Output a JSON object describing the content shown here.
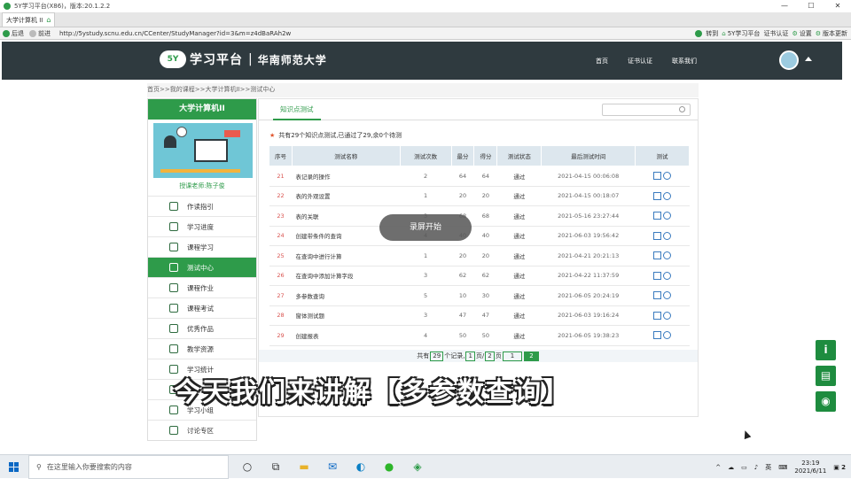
{
  "window": {
    "title": "5Y学习平台(X86)，版本:20.1.2.2"
  },
  "tabs": [
    {
      "label": "大学计算机 II"
    }
  ],
  "address": {
    "back": "后退",
    "forward": "前进",
    "url": "http://5ystudy.scnu.edu.cn/CCenter/StudyManager?id=3&m=z4dBaRAh2w",
    "right_items": [
      "转到",
      "5Y学习平台",
      "证书认证",
      "设置",
      "版本更新"
    ]
  },
  "site": {
    "logo_badge": "5Y",
    "title": "学习平台",
    "separator": "|",
    "university": "华南师范大学",
    "nav": [
      "首页",
      "证书认证",
      "联系我们"
    ]
  },
  "breadcrumb": "首页>>我的课程>>大学计算机II>>测试中心",
  "sidebar": {
    "course": "大学计算机II",
    "teacher_link": "授课老师:陈子俊",
    "items": [
      {
        "label": "作读指引",
        "icon": "chart-icon"
      },
      {
        "label": "学习进度",
        "icon": "progress-icon"
      },
      {
        "label": "课程学习",
        "icon": "graduation-icon"
      },
      {
        "label": "测试中心",
        "icon": "list-icon",
        "active": true
      },
      {
        "label": "课程作业",
        "icon": "homework-icon"
      },
      {
        "label": "课程考试",
        "icon": "exam-icon"
      },
      {
        "label": "优秀作品",
        "icon": "award-icon"
      },
      {
        "label": "教学资源",
        "icon": "resource-icon"
      },
      {
        "label": "学习统计",
        "icon": "stats-icon"
      },
      {
        "label": "课程公告",
        "icon": "notice-icon"
      },
      {
        "label": "学习小组",
        "icon": "group-icon"
      },
      {
        "label": "讨论专区",
        "icon": "discuss-icon"
      }
    ]
  },
  "main": {
    "tab": "知识点测试",
    "summary": "共有29个知识点测试,已通过了29,余0个待测",
    "columns": [
      "序号",
      "测试名称",
      "测试次数",
      "最分",
      "得分",
      "测试状态",
      "最后测试时间",
      "测试"
    ],
    "rows": [
      [
        "21",
        "表记录的操作",
        "2",
        "64",
        "64",
        "通过",
        "2021-04-15 00:06:08"
      ],
      [
        "22",
        "表的外观设置",
        "1",
        "20",
        "20",
        "通过",
        "2021-04-15 00:18:07"
      ],
      [
        "23",
        "表的关联",
        "3",
        "68",
        "68",
        "通过",
        "2021-05-16 23:27:44"
      ],
      [
        "24",
        "创建带条件的查询",
        "4",
        "40",
        "40",
        "通过",
        "2021-06-03 19:56:42"
      ],
      [
        "25",
        "在查询中进行计算",
        "1",
        "20",
        "20",
        "通过",
        "2021-04-21 20:21:13"
      ],
      [
        "26",
        "在查询中添加计算字段",
        "3",
        "62",
        "62",
        "通过",
        "2021-04-22 11:37:59"
      ],
      [
        "27",
        "多参数查询",
        "5",
        "10",
        "30",
        "通过",
        "2021-06-05 20:24:19"
      ],
      [
        "28",
        "窗体测试题",
        "3",
        "47",
        "47",
        "通过",
        "2021-06-03 19:16:24"
      ],
      [
        "29",
        "创建报表",
        "4",
        "50",
        "50",
        "通过",
        "2021-06-05 19:38:23"
      ]
    ],
    "pager": {
      "total_prefix": "共有",
      "total": "29",
      "total_suffix": "个记录,",
      "page": "1",
      "page_sep": "页/",
      "pages": "2",
      "pages_suffix": "页",
      "input": "1",
      "current": "2"
    }
  },
  "toast": "录屏开始",
  "caption": "今天我们来讲解【多参数查询】",
  "float_buttons": [
    "info-icon",
    "clipboard-icon",
    "qq-icon"
  ],
  "taskbar": {
    "search_placeholder": "在这里输入你要搜索的内容",
    "ime": "英",
    "time": "23:19",
    "date": "2021/6/11",
    "notifications": "2"
  },
  "colors": {
    "accent": "#2e9b4a",
    "header": "#2f3a3f",
    "table_header": "#dde7ee"
  }
}
